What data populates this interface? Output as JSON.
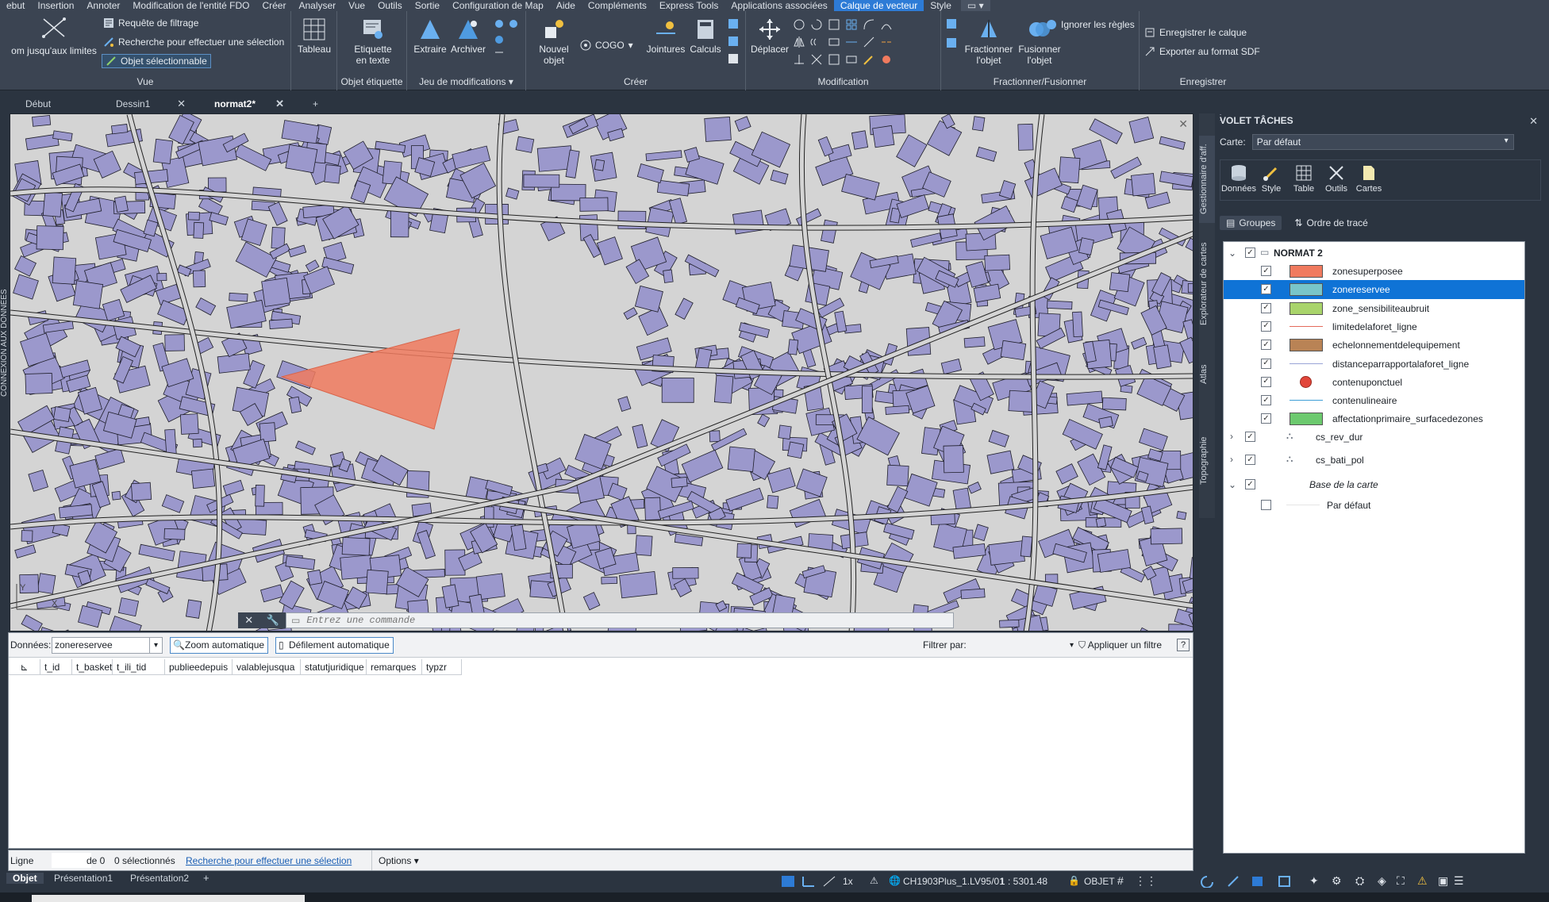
{
  "menubar": {
    "items": [
      "ebut",
      "Insertion",
      "Annoter",
      "Modification de l'entité FDO",
      "Créer",
      "Analyser",
      "Vue",
      "Outils",
      "Sortie",
      "Configuration de Map",
      "Aide",
      "Compléments",
      "Express Tools",
      "Applications associées",
      "Calque de vecteur",
      "Style"
    ],
    "active_index": 14,
    "accent": "#2d7bd6"
  },
  "ribbon": {
    "vue": {
      "zoom_limits": "om jusqu'aux limites",
      "filter_query": "Requête de filtrage",
      "search_select": "Recherche pour effectuer une sélection",
      "selectable_object": "Objet sélectionnable",
      "title": "Vue"
    },
    "table": {
      "label": "Tableau"
    },
    "etiquette": {
      "label_line1": "Etiquette",
      "label_line2": "en texte",
      "title": "Objet étiquette"
    },
    "jeu": {
      "extract": "Extraire",
      "archive": "Archiver",
      "title": "Jeu de modifications"
    },
    "creer": {
      "new_line1": "Nouvel",
      "new_line2": "objet",
      "cogo": "COGO",
      "jointures": "Jointures",
      "calculs": "Calculs",
      "title": "Créer"
    },
    "modification": {
      "move": "Déplacer",
      "title": "Modification"
    },
    "fractionner": {
      "split_line1": "Fractionner",
      "split_line2": "l'objet",
      "merge_line1": "Fusionner",
      "merge_line2": "l'objet",
      "ignore_rules": "Ignorer les règles",
      "title": "Fractionner/Fusionner"
    },
    "enregistrer": {
      "save_layer": "Enregistrer le calque",
      "export_sdf": "Exporter au format SDF",
      "title": "Enregistrer"
    }
  },
  "tabs": [
    {
      "label": "Début",
      "closable": false
    },
    {
      "label": "Dessin1",
      "closable": true
    },
    {
      "label": "normat2*",
      "closable": true,
      "active": true
    }
  ],
  "side_left_label": "CONNEXION AUX DONNÉES",
  "command": {
    "placeholder": "Entrez une commande"
  },
  "datatable": {
    "data_label": "Données:",
    "data_value": "zonereservee",
    "zoom_auto": "Zoom automatique",
    "scroll_auto": "Défilement automatique",
    "filter_label": "Filtrer par:",
    "apply_filter": "Appliquer un filtre",
    "help": "?",
    "columns": [
      "t_id",
      "t_basket",
      "t_ili_tid",
      "publieedepuis",
      "valablejusqua",
      "statutjuridique",
      "remarques",
      "typzr"
    ]
  },
  "datastatus": {
    "line_label": "Ligne",
    "of": "de 0",
    "selected": "0 sélectionnés",
    "search_link": "Recherche pour effectuer une sélection",
    "options": "Options"
  },
  "layout_tabs": [
    "Objet",
    "Présentation1",
    "Présentation2"
  ],
  "statusbar": {
    "scale_ratio": "1x",
    "coord_system": "CH1903Plus_1.LV95/01",
    "scale": "1 : 5301.48",
    "mode": "OBJET"
  },
  "taskpane": {
    "title": "VOLET TÂCHES",
    "vertical_tabs": [
      "Gestionnaire d'aff.",
      "Explorateur de cartes",
      "Atlas",
      "Topographie"
    ],
    "carte_label": "Carte:",
    "carte_value": "Par défaut",
    "tools": [
      "Données",
      "Style",
      "Table",
      "Outils",
      "Cartes"
    ],
    "modes": {
      "groups": "Groupes",
      "draw_order": "Ordre de tracé"
    },
    "group_name": "NORMAT 2",
    "layers": [
      {
        "name": "zonesuperposee",
        "swatch": "fill",
        "color": "#f07a5e",
        "checked": true
      },
      {
        "name": "zonereservee",
        "swatch": "fill",
        "color": "#79c5c9",
        "checked": true,
        "selected": true
      },
      {
        "name": "zone_sensibiliteaubruit",
        "swatch": "fill",
        "color": "#a9d46b",
        "checked": true
      },
      {
        "name": "limitedelaforet_ligne",
        "swatch": "line",
        "color": "#e46b5c",
        "checked": true
      },
      {
        "name": "echelonnementdelequipement",
        "swatch": "fill",
        "color": "#b98355",
        "checked": true
      },
      {
        "name": "distanceparrapportalaforet_ligne",
        "swatch": "line",
        "color": "#9aa4d6",
        "checked": true
      },
      {
        "name": "contenuponctuel",
        "swatch": "point",
        "color": "#e2463a",
        "checked": true
      },
      {
        "name": "contenulineaire",
        "swatch": "line",
        "color": "#3e9fd6",
        "checked": true
      },
      {
        "name": "affectationprimaire_surfacedezones",
        "swatch": "fill",
        "color": "#6cc96e",
        "checked": true
      }
    ],
    "other_layers": [
      {
        "name": "cs_rev_dur",
        "checked": true
      },
      {
        "name": "cs_bati_pol",
        "checked": true
      }
    ],
    "base_group": "Base de la carte",
    "base_default": "Par défaut"
  },
  "map": {
    "building_color": "#9b98cc",
    "background_color": "#d4d4d4",
    "zone_color": "#f07a5e"
  }
}
